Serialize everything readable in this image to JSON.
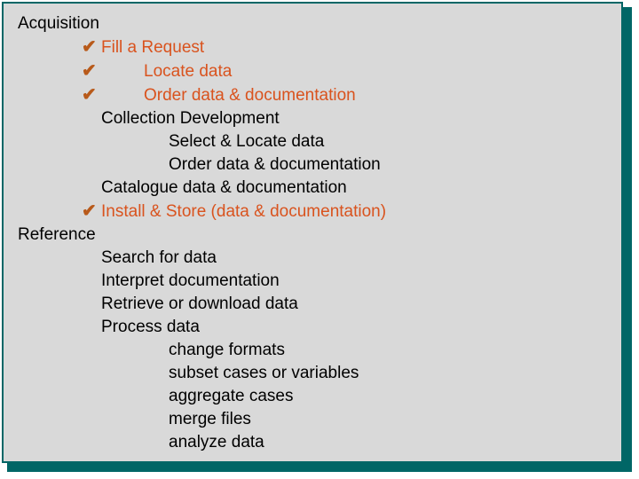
{
  "lines": {
    "acquisition": "Acquisition",
    "fill_request": "Fill a Request",
    "locate_data": "Locate data",
    "order_data_doc": "Order data & documentation",
    "collection_dev": "Collection Development",
    "select_locate": "Select & Locate data",
    "order_data_doc2": "Order data & documentation",
    "catalogue": "Catalogue data & documentation",
    "install_store": "Install & Store (data & documentation)",
    "reference": "Reference",
    "search_data": "Search for data",
    "interpret_doc": "Interpret documentation",
    "retrieve": "Retrieve or download data",
    "process": "Process data",
    "change_formats": "change formats",
    "subset": "subset cases or variables",
    "aggregate": "aggregate cases",
    "merge": "merge files",
    "analyze": "analyze data"
  }
}
